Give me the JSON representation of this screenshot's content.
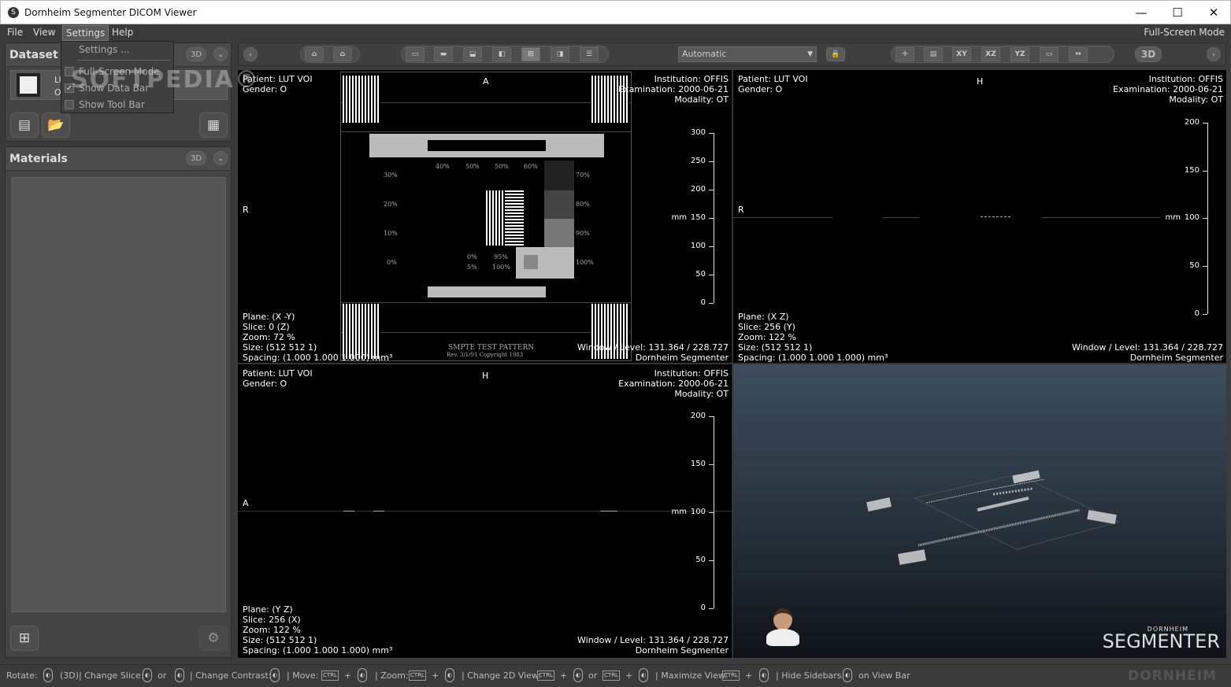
{
  "window": {
    "title": "Dornheim Segmenter DICOM Viewer",
    "minimize": "—",
    "maximize": "☐",
    "close": "✕",
    "app_icon": "S"
  },
  "menu": {
    "items": [
      "File",
      "View",
      "Settings",
      "Help"
    ],
    "fullscreen": "Full-Screen Mode"
  },
  "settings_menu": {
    "items": [
      "Settings ...",
      "Full-Screen Mode",
      "Show Data Bar",
      "Show Tool Bar"
    ],
    "checked": [
      false,
      false,
      true,
      false
    ]
  },
  "watermark": "SOFTPEDIA®",
  "dataset": {
    "title": "Dataset",
    "pill": "3D",
    "item_line1": "LUT VOI",
    "item_line2": "OT"
  },
  "materials": {
    "title": "Materials",
    "pill": "3D"
  },
  "toolbar": {
    "lut_mode": "Automatic",
    "btn_xy": "XY",
    "btn_xz": "XZ",
    "btn_yz": "YZ",
    "btn_3d": "3D"
  },
  "vp_top_left": {
    "patient": "Patient: LUT VOI",
    "gender": "Gender: O",
    "institution": "Institution: OFFIS",
    "examination": "Examination: 2000-06-21",
    "modality": "Modality: OT",
    "orient_top": "A",
    "orient_left": "R",
    "plane": "Plane: (X -Y)",
    "slice": "Slice: 0 (Z)",
    "zoom": "Zoom: 72 %",
    "size": "Size: (512 512 1)",
    "spacing": "Spacing: (1.000 1.000 1.000) mm³",
    "window": "Window / Level: 131.364 / 228.727",
    "brand": "Dornheim Segmenter",
    "scale_unit": "mm",
    "scale_labels": [
      "300",
      "250",
      "200",
      "150",
      "100",
      "50",
      "0"
    ],
    "pattern_pct_top": [
      "40%",
      "50%",
      "50%",
      "60%"
    ],
    "pattern_pct_left": [
      "30%",
      "20%",
      "10%",
      "0%"
    ],
    "pattern_pct_right": [
      "70%",
      "80%",
      "90%",
      "100%"
    ],
    "pattern_pct_inner": [
      "0%",
      "95%",
      "5%",
      "100%"
    ],
    "pattern_caption1": "SMPTE TEST PATTERN",
    "pattern_caption2": "Rev. 3/1/91 Copyright 1983"
  },
  "vp_top_right": {
    "patient": "Patient: LUT VOI",
    "gender": "Gender: O",
    "institution": "Institution: OFFIS",
    "examination": "Examination: 2000-06-21",
    "modality": "Modality: OT",
    "orient_top": "H",
    "orient_left": "R",
    "plane": "Plane: (X Z)",
    "slice": "Slice: 256 (Y)",
    "zoom": "Zoom: 122 %",
    "size": "Size: (512 512 1)",
    "spacing": "Spacing: (1.000 1.000 1.000) mm³",
    "window": "Window / Level: 131.364 / 228.727",
    "brand": "Dornheim Segmenter",
    "scale_unit": "mm",
    "scale_labels": [
      "200",
      "150",
      "100",
      "50",
      "0"
    ]
  },
  "vp_bottom_left": {
    "patient": "Patient: LUT VOI",
    "gender": "Gender: O",
    "institution": "Institution: OFFIS",
    "examination": "Examination: 2000-06-21",
    "modality": "Modality: OT",
    "orient_top": "H",
    "orient_left": "A",
    "plane": "Plane: (Y Z)",
    "slice": "Slice: 256 (X)",
    "zoom": "Zoom: 122 %",
    "size": "Size: (512 512 1)",
    "spacing": "Spacing: (1.000 1.000 1.000) mm³",
    "window": "Window / Level: 131.364 / 228.727",
    "brand": "Dornheim Segmenter",
    "scale_unit": "mm",
    "scale_labels": [
      "200",
      "150",
      "100",
      "50",
      "0"
    ]
  },
  "vp_3d": {
    "logo_small": "DORNHEIM",
    "logo_big": "SEGMENTER"
  },
  "status": {
    "rotate": "Rotate:",
    "rotate_3d": "(3D)",
    "change_slice": "| Change Slice:",
    "or": "or",
    "change_contrast": "| Change Contrast:",
    "move": "| Move:",
    "zoom": "| Zoom:",
    "change_2d": "| Change 2D View:",
    "maximize": "| Maximize View:",
    "hide_sidebars": "| Hide Sidebars:",
    "on_view_bar": "on View Bar",
    "ctrl": "CTRL",
    "plus": "+",
    "brand": "DORNHEIM"
  }
}
